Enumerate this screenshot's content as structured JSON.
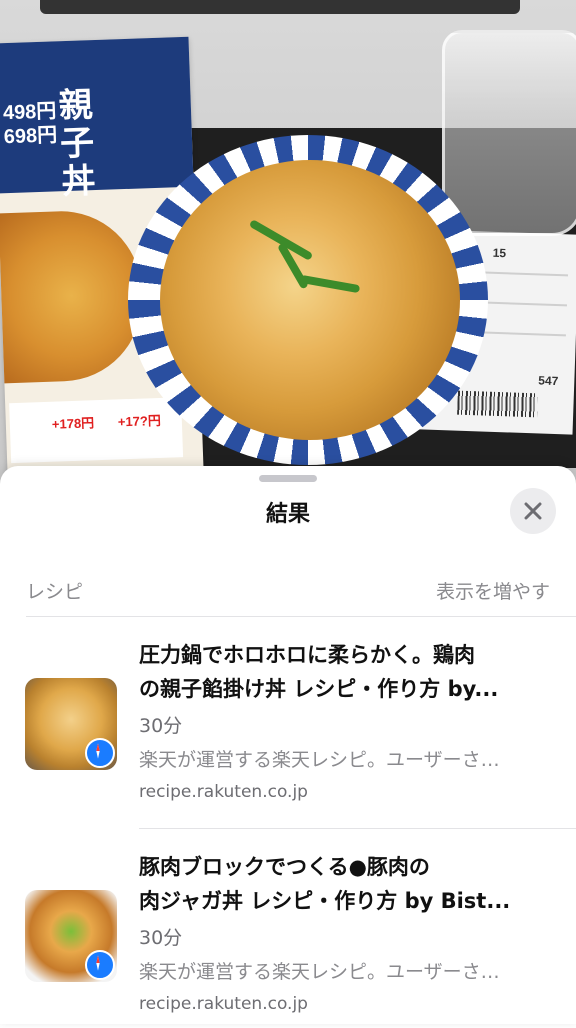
{
  "photo": {
    "menu_title": "親子丼",
    "menu_price": "498円",
    "menu_price2": "698円",
    "menu_chip1": "+178円",
    "menu_chip2": "+17?円",
    "receipt_number": "15",
    "receipt_total": "547"
  },
  "sheet": {
    "title": "結果",
    "close_label": "×"
  },
  "section": {
    "label": "レシピ",
    "more_label": "表示を増やす"
  },
  "results": [
    {
      "title_line1": "圧力鍋でホロホロに柔らかく。鶏肉",
      "title_line2": "の親子餡掛け丼 レシピ・作り方 by...",
      "time": "30分",
      "description": "楽天が運営する楽天レシピ。ユーザーさ…",
      "url": "recipe.rakuten.co.jp",
      "thumbnail_icon": "rice-bowl-thumbnail",
      "badge_icon": "safari-icon"
    },
    {
      "title_line1": "豚肉ブロックでつくる●豚肉の",
      "title_line2": "肉ジャガ丼 レシピ・作り方 by Bist...",
      "time": "30分",
      "description": "楽天が運営する楽天レシピ。ユーザーさ…",
      "url": "recipe.rakuten.co.jp",
      "thumbnail_icon": "rice-bowl-thumbnail",
      "badge_icon": "safari-icon"
    }
  ],
  "colors": {
    "accent_blue": "#1a7cff",
    "text_primary": "#111111",
    "text_secondary": "#8a8a8e"
  }
}
